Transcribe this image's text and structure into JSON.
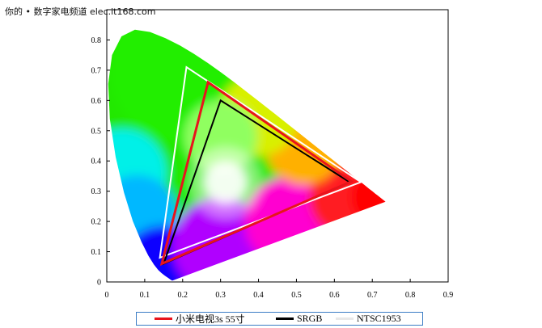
{
  "watermark": "你的 • 数字家电频道 elec.it168.com",
  "chart_data": {
    "type": "scatter",
    "title": "",
    "xlabel": "",
    "ylabel": "",
    "xlim": [
      0,
      0.9
    ],
    "ylim": [
      0,
      0.9
    ],
    "xticks": [
      "0",
      "0.1",
      "0.2",
      "0.3",
      "0.4",
      "0.5",
      "0.6",
      "0.7",
      "0.8",
      "0.9"
    ],
    "yticks": [
      "0",
      "0.1",
      "0.2",
      "0.3",
      "0.4",
      "0.5",
      "0.6",
      "0.7",
      "0.8"
    ],
    "grid": false,
    "legend_position": "bottom",
    "background": "CIE 1931 chromaticity diagram (spectral locus)",
    "series": [
      {
        "name": "小米电视3s 55寸",
        "color": "#e8141c",
        "closed": true,
        "points": [
          [
            0.645,
            0.332
          ],
          [
            0.267,
            0.66
          ],
          [
            0.145,
            0.06
          ]
        ]
      },
      {
        "name": "SRGB",
        "color": "#000000",
        "closed": true,
        "points": [
          [
            0.64,
            0.33
          ],
          [
            0.3,
            0.6
          ],
          [
            0.15,
            0.06
          ]
        ]
      },
      {
        "name": "NTSC1953",
        "color": "#ffffff",
        "closed": true,
        "points": [
          [
            0.67,
            0.33
          ],
          [
            0.21,
            0.71
          ],
          [
            0.14,
            0.08
          ]
        ]
      }
    ]
  }
}
